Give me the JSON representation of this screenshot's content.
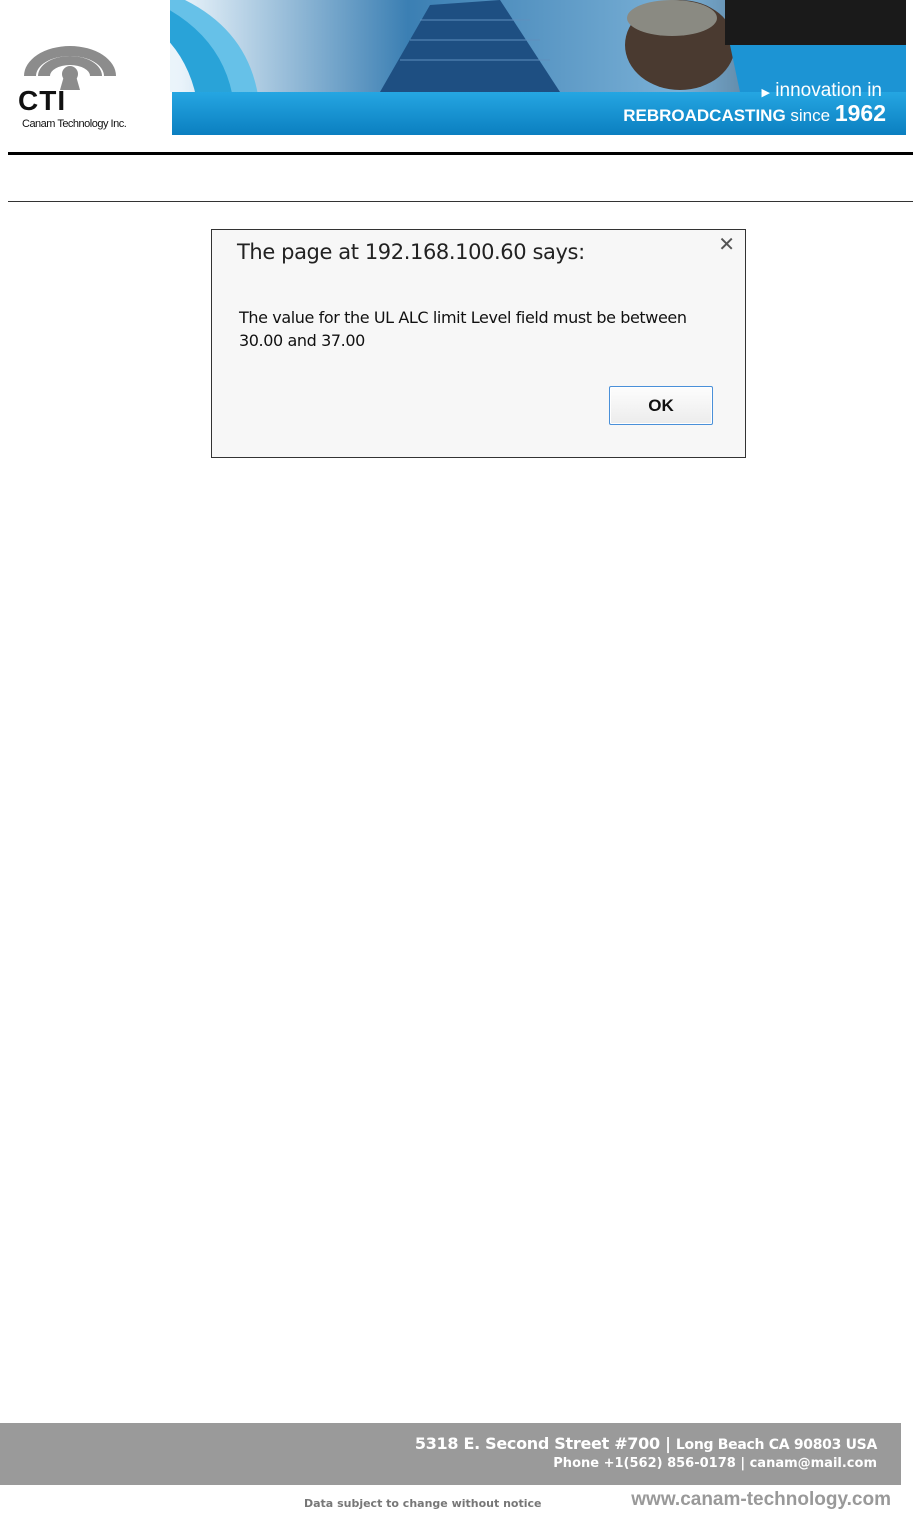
{
  "header": {
    "logo_name": "CTI",
    "logo_subtitle": "Canam Technology Inc.",
    "tagline_line1": "innovation in",
    "tagline_rebroadcasting": "REBROADCASTING",
    "tagline_since": "since",
    "tagline_year": "1962",
    "colors": {
      "banner_blue": "#1a8fcf",
      "banner_dark": "#0b5f94"
    }
  },
  "dialog": {
    "title": "The page at 192.168.100.60 says:",
    "message": "The value for the UL ALC limit Level field must be between 30.00 and 37.00",
    "ok_label": "OK",
    "close_icon": "close-icon"
  },
  "footer": {
    "address_street": "5318 E. Second Street  #700 |",
    "address_city": "Long Beach CA 90803 USA",
    "contact": "Phone +1(562) 856-0178 | canam@mail.com",
    "notice": "Data subject to change without notice",
    "website": "www.canam-technology.com"
  }
}
